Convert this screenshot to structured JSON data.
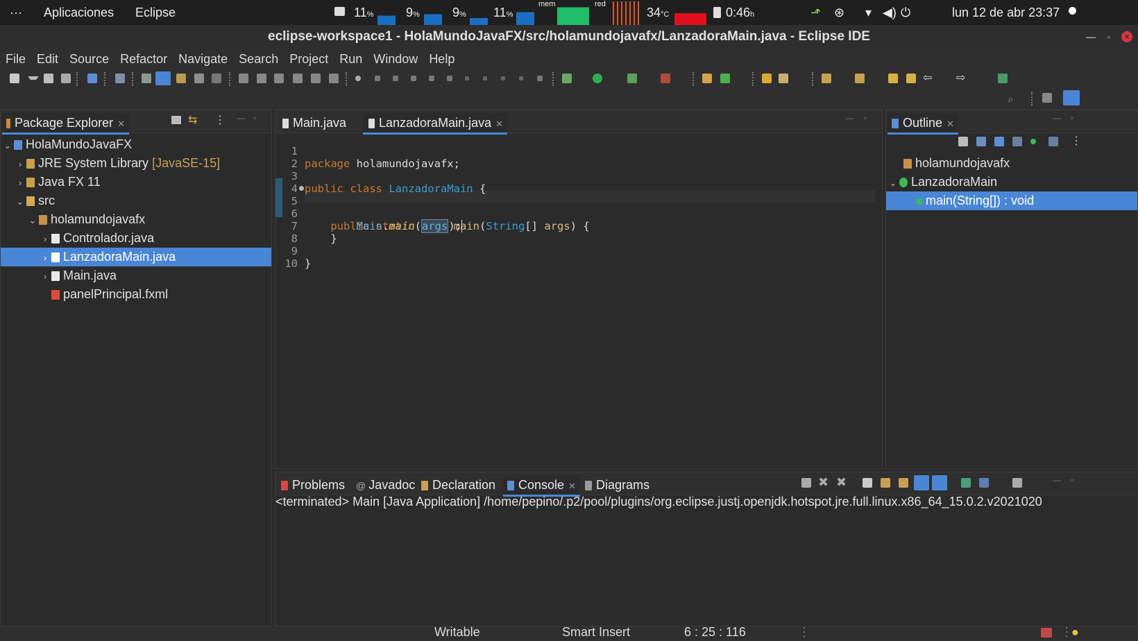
{
  "system_bar": {
    "dots": "···",
    "apps": "Aplicaciones",
    "active_app": "Eclipse",
    "cpu": [
      "11",
      "9",
      "9",
      "11"
    ],
    "percent": "%",
    "mem_label": "mem",
    "net_label": "red",
    "temp": "34",
    "temp_unit": "°C",
    "battery": "0:46",
    "battery_unit": "h",
    "clock": "lun 12 de abr  23:37"
  },
  "window": {
    "title": "eclipse-workspace1 - HolaMundoJavaFX/src/holamundojavafx/LanzadoraMain.java - Eclipse IDE"
  },
  "menu": [
    "File",
    "Edit",
    "Source",
    "Refactor",
    "Navigate",
    "Search",
    "Project",
    "Run",
    "Window",
    "Help"
  ],
  "package_explorer": {
    "tab_label": "Package Explorer",
    "items": [
      {
        "label": "HolaMundoJavaFX",
        "suffix": ""
      },
      {
        "label": "JRE System Library",
        "suffix": "[JavaSE-15]"
      },
      {
        "label": "Java FX 11",
        "suffix": ""
      },
      {
        "label": "src",
        "suffix": ""
      },
      {
        "label": "holamundojavafx",
        "suffix": ""
      },
      {
        "label": "Controlador.java",
        "suffix": ""
      },
      {
        "label": "LanzadoraMain.java",
        "suffix": ""
      },
      {
        "label": "Main.java",
        "suffix": ""
      },
      {
        "label": "panelPrincipal.fxml",
        "suffix": ""
      }
    ]
  },
  "editor": {
    "tabs": [
      "Main.java",
      "LanzadoraMain.java"
    ],
    "line_numbers": [
      "1",
      "2",
      "3",
      "4",
      "5",
      "6",
      "7",
      "8",
      "9",
      "10"
    ],
    "code": {
      "l1_kw": "package",
      "l1_rest": " holamundojavafx;",
      "l3_kw": "public class",
      "l3_name": "LanzadoraMain",
      "l3_rest": " {",
      "l5_kw": "public static void",
      "l5_fn": "main",
      "l5_open": "(",
      "l5_type": "String",
      "l5_arr": "[] ",
      "l5_arg": "args",
      "l5_rest": ") {",
      "l6_cls": "Main",
      "l6_dot": ".",
      "l6_fn": "main",
      "l6_open": "(",
      "l6_arg": "args",
      "l6_rest": ");",
      "l7": "}",
      "l9": "}"
    }
  },
  "outline": {
    "tab_label": "Outline",
    "items": [
      "holamundojavafx",
      "LanzadoraMain",
      "main(String[]) : void"
    ]
  },
  "bottom_panel": {
    "tabs": [
      "Problems",
      "Javadoc",
      "Declaration",
      "Console",
      "Diagrams"
    ],
    "console_text": "<terminated> Main [Java Application] /home/pepino/.p2/pool/plugins/org.eclipse.justj.openjdk.hotspot.jre.full.linux.x86_64_15.0.2.v2021020"
  },
  "status_bar": {
    "writable": "Writable",
    "insert_mode": "Smart Insert",
    "position": "6 : 25 : 116"
  },
  "colors": {
    "selection": "#4a86d6",
    "keyword": "#cc7832",
    "type": "#3e9bd0",
    "method": "#d7ba7d",
    "mem_graph": "#1fbd69",
    "temp_graph": "#e0101e",
    "cpu_graph": "#1b6fc2"
  }
}
